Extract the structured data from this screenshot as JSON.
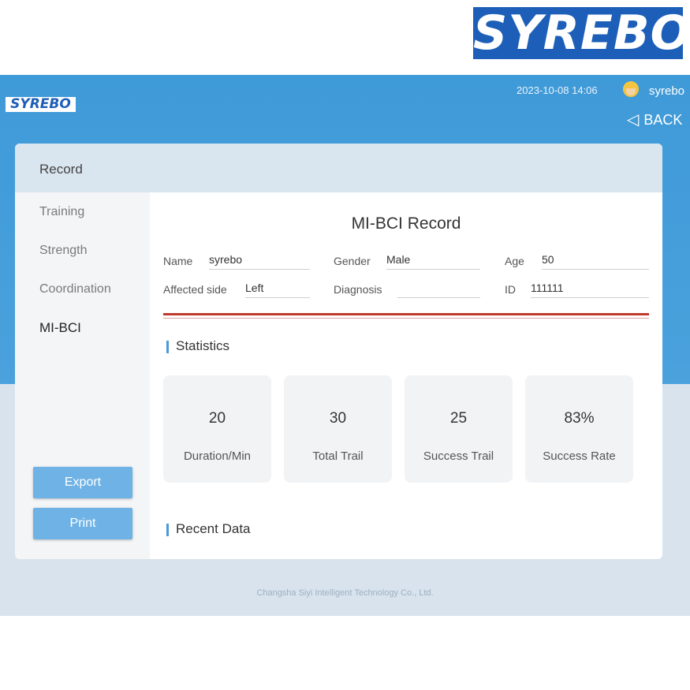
{
  "brand": {
    "logo_text": "SYREBO",
    "mini_logo_text": "SYREBO"
  },
  "header": {
    "datetime": "2023-10-08 14:06",
    "username": "syrebo",
    "back_label": "BACK",
    "back_icon": "back-arrow-icon",
    "user_icon": "avatar-icon"
  },
  "card": {
    "header_title": "Record"
  },
  "sidebar": {
    "items": [
      {
        "label": "Training",
        "active": false
      },
      {
        "label": "Strength",
        "active": false
      },
      {
        "label": "Coordination",
        "active": false
      },
      {
        "label": "MI-BCI",
        "active": true
      }
    ],
    "export_label": "Export",
    "print_label": "Print"
  },
  "main": {
    "title": "MI-BCI Record",
    "fields": {
      "name_label": "Name",
      "name_value": "syrebo",
      "gender_label": "Gender",
      "gender_value": "Male",
      "age_label": "Age",
      "age_value": "50",
      "affected_label": "Affected side",
      "affected_value": "Left",
      "diagnosis_label": "Diagnosis",
      "diagnosis_value": "",
      "id_label": "ID",
      "id_value": "111111"
    },
    "statistics_title": "Statistics",
    "stats": [
      {
        "value": "20",
        "label": "Duration/Min"
      },
      {
        "value": "30",
        "label": "Total Trail"
      },
      {
        "value": "25",
        "label": "Success Trail"
      },
      {
        "value": "83%",
        "label": "Success Rate"
      }
    ],
    "recent_title": "Recent Data"
  },
  "footer": {
    "text": "Changsha Siyi Intelligent Technology Co., Ltd."
  },
  "colors": {
    "accent": "#4aa1dc",
    "brand": "#1d5fb8",
    "button": "#6fb3e6",
    "divider": "#c0392b"
  }
}
